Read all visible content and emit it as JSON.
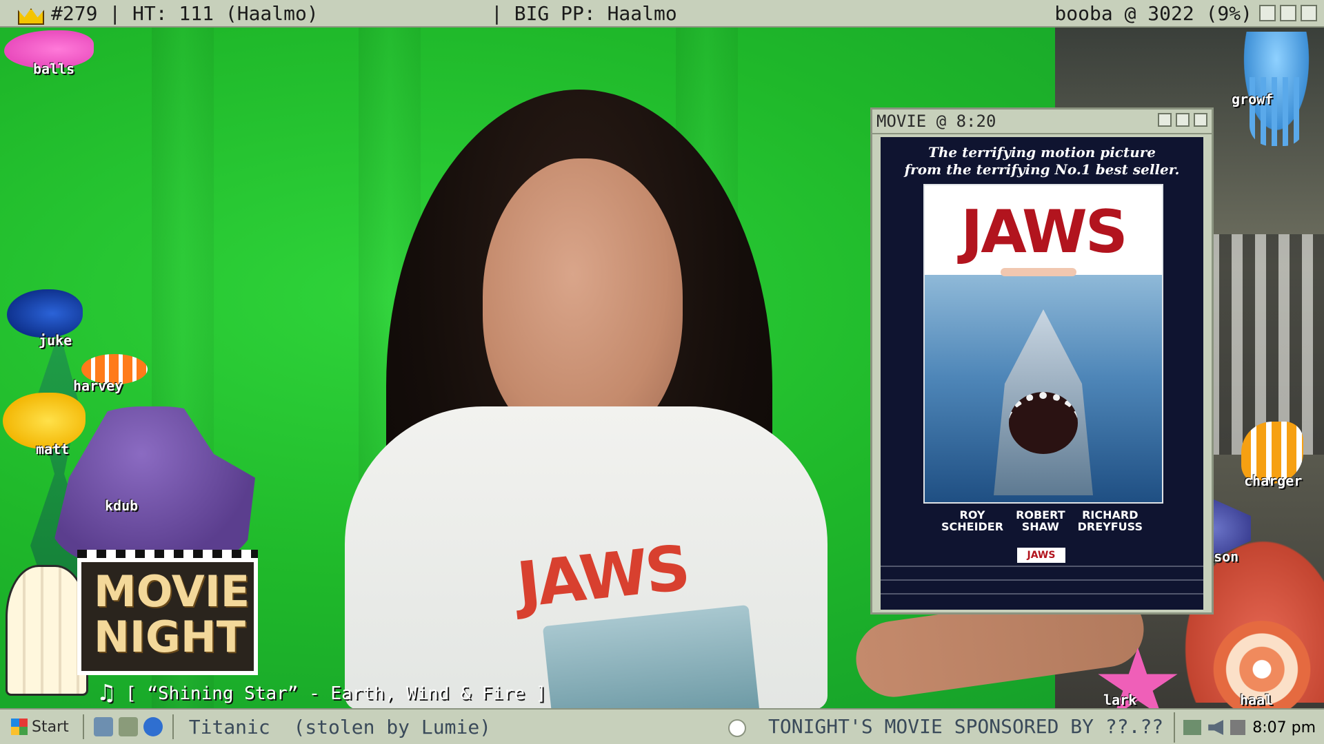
{
  "topbar": {
    "left_text": "#279 | HT: 111 (Haalmo)",
    "middle_text": "| BIG PP: Haalmo",
    "right_text": "booba @ 3022 (9%)"
  },
  "movie_window": {
    "title": "MOVIE @ 8:20",
    "poster": {
      "tagline_line1": "The terrifying motion picture",
      "tagline_line2": "from the terrifying No.1 best seller.",
      "logo": "JAWS",
      "credit1": "ROY\nSCHEIDER",
      "credit2": "ROBERT\nSHAW",
      "credit3": "RICHARD\nDREYFUSS",
      "mini_logo": "JAWS"
    }
  },
  "shirt_print": "JAWS",
  "fish": {
    "pink": "balls",
    "blue": "juke",
    "clown": "harvey",
    "yellow": "matt",
    "octopus": "kdub",
    "jelly": "growf",
    "angel": "charger",
    "purple": "bison",
    "starfish": "lark",
    "shell": "haal"
  },
  "sign": {
    "text": "MOVIE\nNIGHT"
  },
  "now_playing": "[ “Shining Star” - Earth, Wind & Fire ]",
  "taskbar": {
    "start_label": "Start",
    "active_window": "Titanic  (stolen by Lumie)",
    "ticker": "TONIGHT'S MOVIE SPONSORED BY ??.??",
    "clock": "8:07 pm"
  },
  "colors": {
    "bar_bg": "#c7d0bb",
    "green_screen": "#1fb82a",
    "jaws_red": "#b2141e"
  }
}
